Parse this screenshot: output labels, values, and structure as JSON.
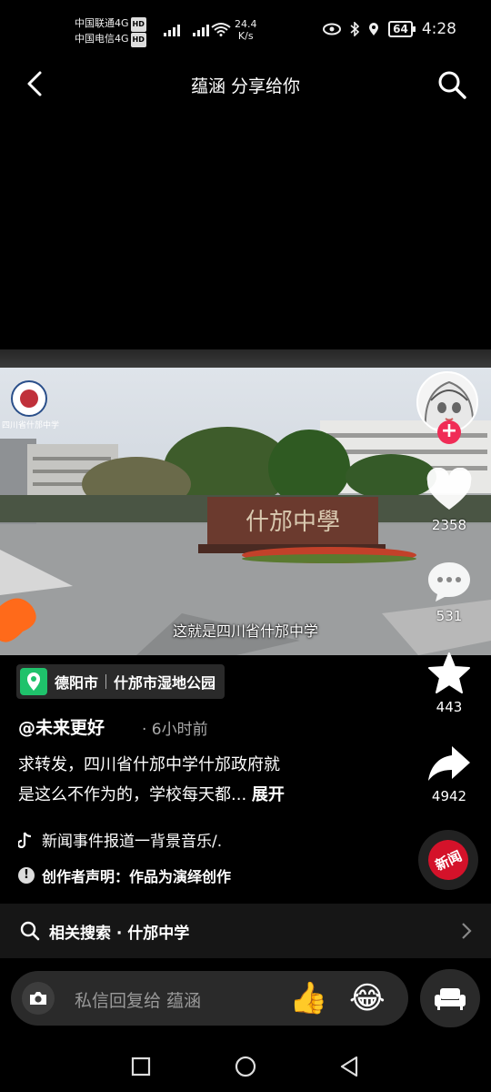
{
  "status_bar": {
    "carrier1": "中国联通4G",
    "carrier2": "中国电信4G",
    "hd": "HD",
    "net_tag": "4G",
    "net_speed_value": "24.4",
    "net_speed_unit": "K/s",
    "battery": "64",
    "time": "4:28"
  },
  "header": {
    "title": "蕴涵 分享给你"
  },
  "video": {
    "subtitle": "这就是四川省什邡中学",
    "school_sign": "什邡中學",
    "watermark": "四川省什邡中学"
  },
  "rail": {
    "likes": "2358",
    "comments": "531",
    "favorites": "443",
    "shares": "4942",
    "disc_label": "新闻"
  },
  "info": {
    "location_city": "德阳市",
    "location_place": "什邡市湿地公园",
    "author": "@未来更好",
    "time": "· 6小时前",
    "desc_line1": "求转发，四川省什邡中学什邡政府就",
    "desc_line2": "是这么不作为的，学校每天都...",
    "expand": "展开",
    "music": "新闻事件报道一背景音乐/.",
    "notice_icon": "!",
    "notice": "创作者声明：作品为演绎创作"
  },
  "related": {
    "label": "相关搜索 · 什邡中学"
  },
  "message": {
    "placeholder": "私信回复给 蕴涵",
    "emoji_thumb": "👍",
    "emoji_laugh": "😂"
  },
  "colors": {
    "accent": "#f02c56",
    "location_green": "#1fc26b"
  },
  "icons": [
    "back-icon",
    "search-icon",
    "heart-icon",
    "comment-icon",
    "star-icon",
    "share-icon",
    "music-icon",
    "camera-icon",
    "sofa-icon"
  ]
}
